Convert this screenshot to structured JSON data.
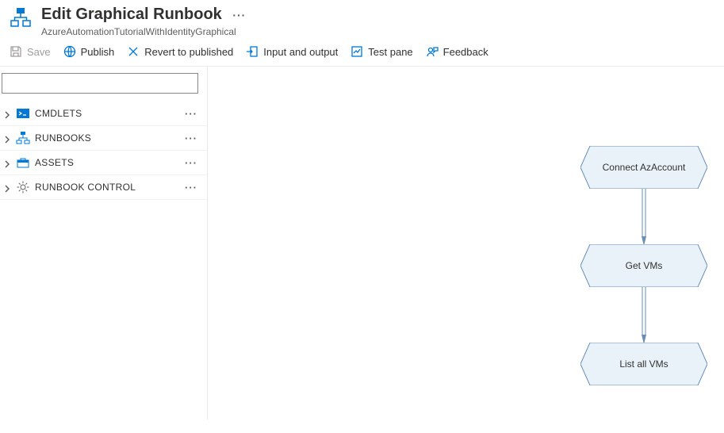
{
  "header": {
    "title": "Edit Graphical Runbook",
    "subtitle": "AzureAutomationTutorialWithIdentityGraphical"
  },
  "toolbar": {
    "save": "Save",
    "publish": "Publish",
    "revert": "Revert to published",
    "io": "Input and output",
    "test": "Test pane",
    "feedback": "Feedback"
  },
  "search": {
    "value": ""
  },
  "library": {
    "items": [
      {
        "label": "CMDLETS"
      },
      {
        "label": "RUNBOOKS"
      },
      {
        "label": "ASSETS"
      },
      {
        "label": "RUNBOOK CONTROL"
      }
    ]
  },
  "canvas": {
    "nodes": [
      {
        "label": "Connect AzAccount"
      },
      {
        "label": "Get VMs"
      },
      {
        "label": "List all VMs"
      }
    ]
  },
  "chart_data": {
    "type": "table",
    "description": "Graphical runbook workflow — directed flow of activities",
    "nodes": [
      "Connect AzAccount",
      "Get VMs",
      "List all VMs"
    ],
    "edges": [
      {
        "from": "Connect AzAccount",
        "to": "Get VMs"
      },
      {
        "from": "Get VMs",
        "to": "List all VMs"
      }
    ]
  }
}
